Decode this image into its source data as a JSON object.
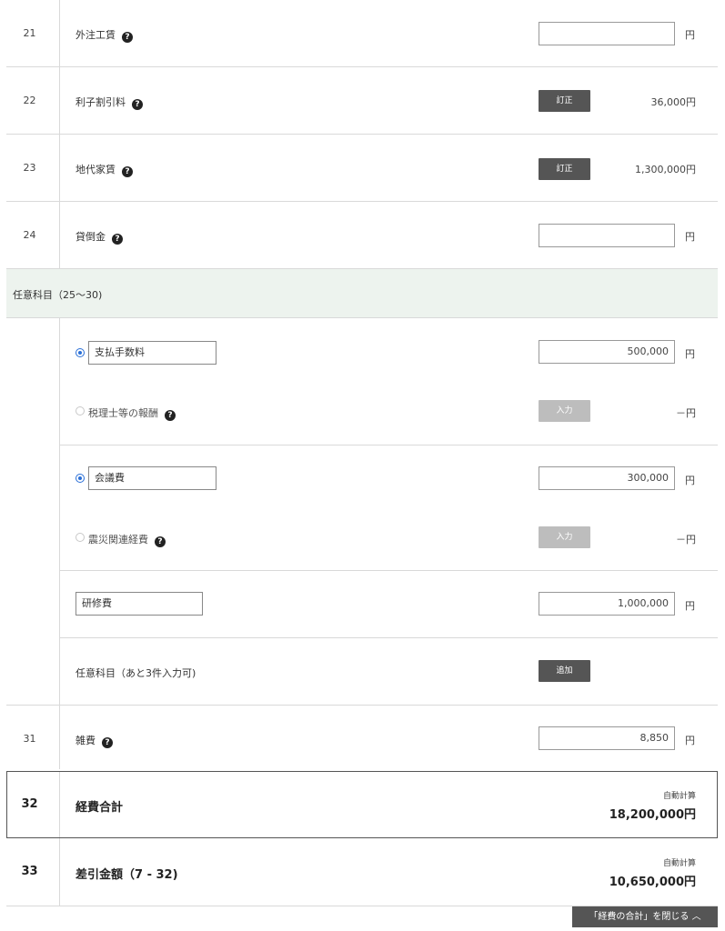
{
  "rows": {
    "r21": {
      "num": "21",
      "label": "外注工賃",
      "unit": "円"
    },
    "r22": {
      "num": "22",
      "label": "利子割引料",
      "button": "訂正",
      "value": "36,000円"
    },
    "r23": {
      "num": "23",
      "label": "地代家賃",
      "button": "訂正",
      "value": "1,300,000円"
    },
    "r24": {
      "num": "24",
      "label": "貸倒金",
      "unit": "円"
    },
    "r31": {
      "num": "31",
      "label": "雑費",
      "value": "8,850",
      "unit": "円"
    },
    "r32": {
      "num": "32",
      "label": "経費合計",
      "auto_label": "自動計算",
      "value": "18,200,000円"
    },
    "r33": {
      "num": "33",
      "label": "差引金額（7 - 32)",
      "auto_label": "自動計算",
      "value": "10,650,000円"
    }
  },
  "optional": {
    "section_title": "任意科目（25〜30)",
    "group1": {
      "custom_name": "支払手数料",
      "custom_value": "500,000",
      "unit": "円",
      "alt_label": "税理士等の報酬",
      "alt_button": "入力",
      "alt_value": "－円"
    },
    "group2": {
      "custom_name": "会議費",
      "custom_value": "300,000",
      "unit": "円",
      "alt_label": "震災関連経費",
      "alt_button": "入力",
      "alt_value": "－円"
    },
    "group3": {
      "custom_name": "研修費",
      "custom_value": "1,000,000",
      "unit": "円"
    },
    "add_row": {
      "label": "任意科目（あと3件入力可)",
      "button": "追加"
    }
  },
  "help_glyph": "?",
  "close_button": "「経費の合計」を閉じる ︿",
  "colors": {
    "section_bg": "#edf3ee",
    "button_dark": "#555555",
    "button_disabled": "#bdbdbd",
    "radio_accent": "#2a6fd6"
  }
}
